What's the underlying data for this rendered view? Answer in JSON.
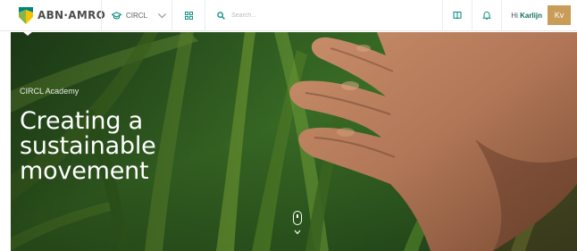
{
  "brand": {
    "name": "ABN·AMRO"
  },
  "context_switch": {
    "label": "CIRCL",
    "icon": "circl-graduation-icon",
    "chevron": "chevron-down-icon"
  },
  "apps_icon": "grid-icon",
  "search": {
    "placeholder": "Search...",
    "value": "",
    "icon": "search-icon"
  },
  "actions": [
    {
      "name": "book-icon"
    },
    {
      "name": "bell-icon"
    }
  ],
  "user": {
    "greeting": "Hi",
    "first_name": "Karlijn",
    "initials": "Kv"
  },
  "hero": {
    "eyebrow": "CIRCL Academy",
    "headline": [
      "Creating a",
      "sustainable",
      "movement"
    ],
    "scroll_hint": "scroll-mouse-icon"
  },
  "colors": {
    "brand_green": "#00857a",
    "brand_yellow": "#f5c400",
    "accent_teal": "#0f6f64",
    "avatar_bg": "#c99c58"
  }
}
